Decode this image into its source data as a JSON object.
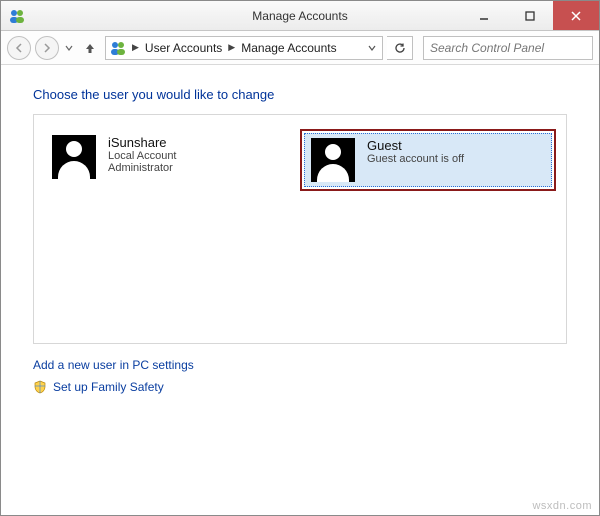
{
  "window": {
    "title": "Manage Accounts"
  },
  "breadcrumb": {
    "seg1": "User Accounts",
    "seg2": "Manage Accounts"
  },
  "search": {
    "placeholder": "Search Control Panel"
  },
  "page": {
    "heading": "Choose the user you would like to change"
  },
  "accounts": [
    {
      "name": "iSunshare",
      "line1": "Local Account",
      "line2": "Administrator"
    },
    {
      "name": "Guest",
      "line1": "Guest account is off",
      "line2": ""
    }
  ],
  "links": {
    "add_user": "Add a new user in PC settings",
    "family_safety": "Set up Family Safety"
  },
  "watermark": "wsxdn.com"
}
